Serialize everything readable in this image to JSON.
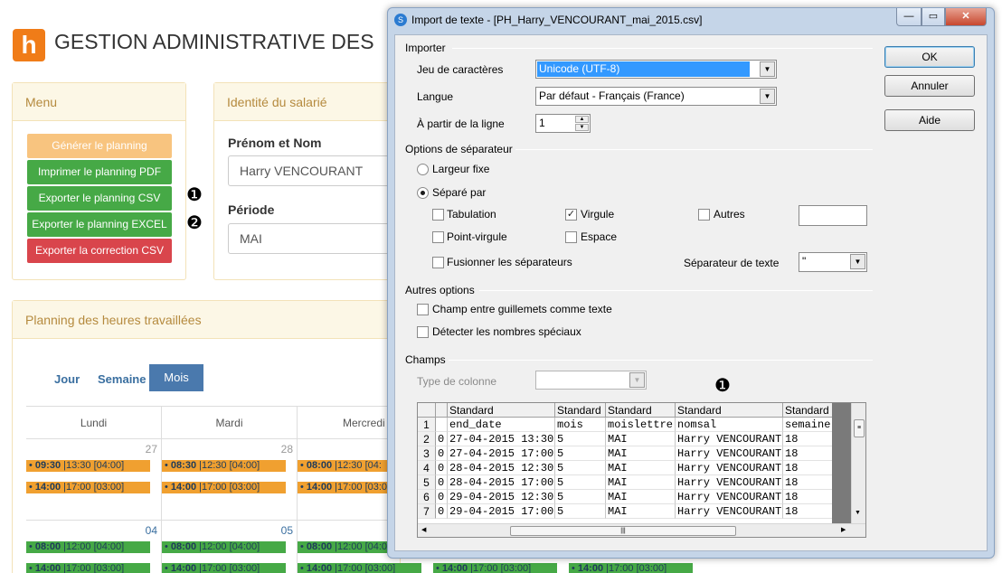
{
  "app": {
    "logo_letter": "h",
    "title": "GESTION ADMINISTRATIVE DES",
    "accent": "#f07c18"
  },
  "menu": {
    "heading": "Menu",
    "buttons": [
      {
        "label": "Générer le planning",
        "color": "#f8c47f"
      },
      {
        "label": "Imprimer le planning PDF",
        "color": "#46a946"
      },
      {
        "label": "Exporter le planning CSV",
        "color": "#46a946"
      },
      {
        "label": "Exporter le planning EXCEL",
        "color": "#46a946"
      },
      {
        "label": "Exporter la correction CSV",
        "color": "#d9454c"
      }
    ],
    "markers": [
      "❶",
      "❷"
    ]
  },
  "identity": {
    "heading": "Identité du salarié",
    "name_label": "Prénom et Nom",
    "name_value": "Harry VENCOURANT",
    "period_label": "Période",
    "period_value": "MAI"
  },
  "planning": {
    "heading": "Planning des heures travaillées",
    "views": [
      "Jour",
      "Semaine",
      "Mois"
    ],
    "active_view": "Mois",
    "day_headers": [
      "Lundi",
      "Mardi",
      "Mercredi"
    ],
    "week1": {
      "dates": [
        "27",
        "28"
      ],
      "events": [
        [
          "09:30",
          "|13:30 [04:00]"
        ],
        [
          "14:00",
          "|17:00 [03:00]"
        ],
        [
          "08:30",
          "|12:30 [04:00]"
        ],
        [
          "14:00",
          "|17:00 [03:00]"
        ],
        [
          "08:00",
          "|12:30 [04:"
        ],
        [
          "14:00",
          "|17:00 [03:00]"
        ]
      ]
    },
    "week2": {
      "dates": [
        "04",
        "05"
      ],
      "events": [
        [
          "08:00",
          "|12:00 [04:00]"
        ],
        [
          "14:00",
          "|17:00 [03:00]"
        ],
        [
          "08:00",
          "|12:00 [04:00]"
        ],
        [
          "14:00",
          "|17:00 [03:00]"
        ],
        [
          "08:00",
          "|12:00 [04:00]"
        ],
        [
          "14:00",
          "|17:00 [03:00]"
        ],
        [
          "14:00",
          "|17:00 [03:00]"
        ],
        [
          "14:00",
          "|17:00 [03:00]"
        ]
      ]
    }
  },
  "dialog": {
    "title": "Import de texte - [PH_Harry_VENCOURANT_mai_2015.csv]",
    "window_buttons": [
      "minimize-icon",
      "maximize-icon",
      "close-icon"
    ],
    "importer": {
      "section": "Importer",
      "charset_label": "Jeu de caractères",
      "charset_value": "Unicode (UTF-8)",
      "language_label": "Langue",
      "language_value": "Par défaut - Français (France)",
      "from_line_label": "À partir de la ligne",
      "from_line_value": "1"
    },
    "separator": {
      "section": "Options de séparateur",
      "fixed_width": "Largeur fixe",
      "separated_by": "Séparé par",
      "selected_mode": "separated_by",
      "tab": "Tabulation",
      "comma": "Virgule",
      "others": "Autres",
      "semicolon": "Point-virgule",
      "space": "Espace",
      "merge": "Fusionner les séparateurs",
      "text_sep_label": "Séparateur de texte",
      "text_sep_value": "\"",
      "comma_checked": "✓"
    },
    "other_options": {
      "section": "Autres options",
      "quoted_as_text": "Champ entre guillemets comme texte",
      "detect_special": "Détecter les nombres spéciaux"
    },
    "fields": {
      "section": "Champs",
      "column_type_label": "Type de colonne",
      "marker": "❶",
      "column_headers": [
        "Standard",
        "Standard",
        "Standard",
        "Standard",
        "Standard"
      ],
      "rows": [
        {
          "n": "1",
          "pre": "",
          "c": [
            "end_date",
            "mois",
            "moislettre",
            "nomsal",
            "semaine"
          ]
        },
        {
          "n": "2",
          "pre": "0",
          "c": [
            "27-04-2015 13:30",
            "5",
            "MAI",
            "Harry VENCOURANT",
            "18"
          ]
        },
        {
          "n": "3",
          "pre": "0",
          "c": [
            "27-04-2015 17:00",
            "5",
            "MAI",
            "Harry VENCOURANT",
            "18"
          ]
        },
        {
          "n": "4",
          "pre": "0",
          "c": [
            "28-04-2015 12:30",
            "5",
            "MAI",
            "Harry VENCOURANT",
            "18"
          ]
        },
        {
          "n": "5",
          "pre": "0",
          "c": [
            "28-04-2015 17:00",
            "5",
            "MAI",
            "Harry VENCOURANT",
            "18"
          ]
        },
        {
          "n": "6",
          "pre": "0",
          "c": [
            "29-04-2015 12:30",
            "5",
            "MAI",
            "Harry VENCOURANT",
            "18"
          ]
        },
        {
          "n": "7",
          "pre": "0",
          "c": [
            "29-04-2015 17:00",
            "5",
            "MAI",
            "Harry VENCOURANT",
            "18"
          ]
        }
      ]
    },
    "buttons": {
      "ok": "OK",
      "cancel": "Annuler",
      "help": "Aide"
    }
  }
}
